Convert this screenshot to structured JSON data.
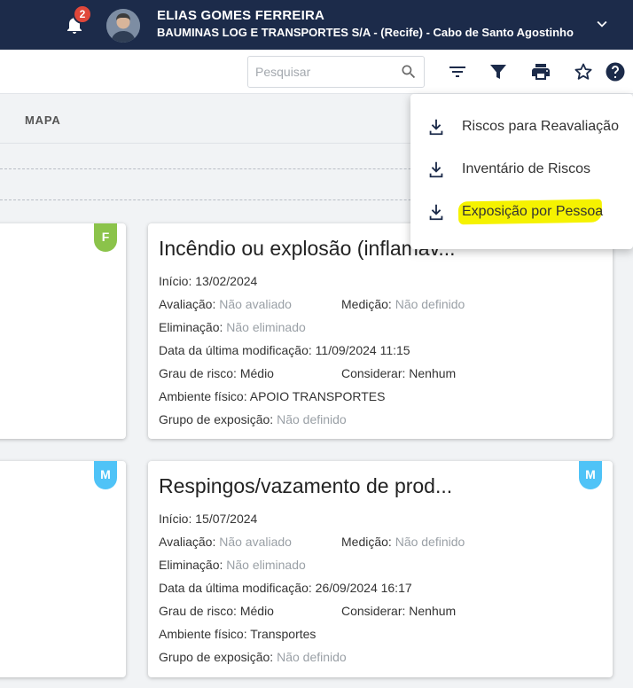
{
  "header": {
    "notification_count": "2",
    "user_name": "ELIAS GOMES FERREIRA",
    "company": "BAUMINAS LOG E TRANSPORTES S/A - (Recife) - Cabo de Santo Agostinho"
  },
  "toolbar": {
    "search_placeholder": "Pesquisar",
    "icons": [
      "search-icon",
      "filter-list-icon",
      "funnel-icon",
      "print-icon",
      "star-icon",
      "help-icon"
    ]
  },
  "tabs": {
    "mapa": "MAPA"
  },
  "menu": {
    "items": [
      {
        "label": "Riscos para Reavaliação",
        "icon": "download-icon"
      },
      {
        "label": "Inventário de Riscos",
        "icon": "download-icon"
      },
      {
        "label": "Exposição por Pessoa",
        "icon": "download-icon",
        "highlighted": true
      }
    ]
  },
  "cards": [
    {
      "title": "Incêndio ou explosão (inflamáv...",
      "badge": "",
      "inicio_label": "Início:",
      "inicio": "13/02/2024",
      "avaliacao_label": "Avaliação:",
      "avaliacao": "Não avaliado",
      "medicao_label": "Medição:",
      "medicao": "Não definido",
      "eliminacao_label": "Eliminação:",
      "eliminacao": "Não eliminado",
      "modificacao_label": "Data da última modificação:",
      "modificacao": "11/09/2024 11:15",
      "grau_label": "Grau de risco:",
      "grau": "Médio",
      "considerar_label": "Considerar:",
      "considerar": "Nenhum",
      "ambiente_label": "Ambiente físico:",
      "ambiente": "APOIO TRANSPORTES",
      "grupo_label": "Grupo de exposição:",
      "grupo": "Não definido"
    },
    {
      "title": "Respingos/vazamento de prod...",
      "badge": "M",
      "inicio_label": "Início:",
      "inicio": "15/07/2024",
      "avaliacao_label": "Avaliação:",
      "avaliacao": "Não avaliado",
      "medicao_label": "Medição:",
      "medicao": "Não definido",
      "eliminacao_label": "Eliminação:",
      "eliminacao": "Não eliminado",
      "modificacao_label": "Data da última modificação:",
      "modificacao": "26/09/2024 16:17",
      "grau_label": "Grau de risco:",
      "grau": "Médio",
      "considerar_label": "Considerar:",
      "considerar": "Nenhum",
      "ambiente_label": "Ambiente físico:",
      "ambiente": "Transportes",
      "grupo_label": "Grupo de exposição:",
      "grupo": "Não definido"
    }
  ],
  "left_cards": [
    {
      "badge": "F",
      "color": "#8bc34a"
    },
    {
      "badge": "M",
      "color": "#4fc3f7"
    }
  ],
  "colors": {
    "header_bg": "#1c2b4a",
    "badge_red": "#e0473a",
    "highlight": "#f5f200",
    "badge_blue": "#4fc3f7",
    "badge_green": "#8bc34a"
  }
}
